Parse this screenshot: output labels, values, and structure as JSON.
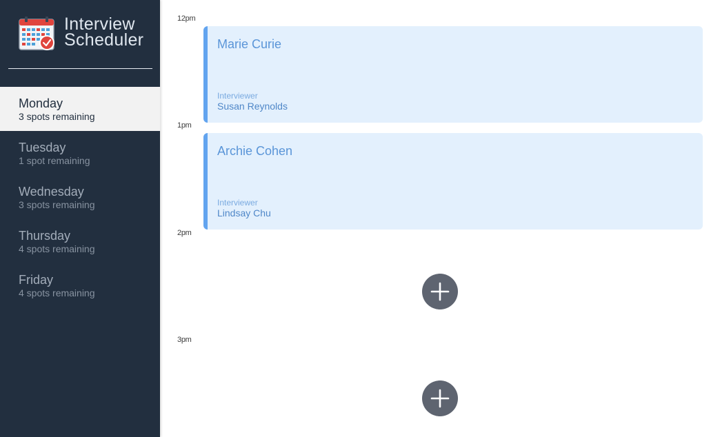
{
  "app": {
    "title_line1": "Interview",
    "title_line2": "Scheduler",
    "logo_icon": "calendar-check-icon"
  },
  "days": [
    {
      "name": "Monday",
      "spots": "3 spots remaining",
      "selected": true
    },
    {
      "name": "Tuesday",
      "spots": "1 spot remaining",
      "selected": false
    },
    {
      "name": "Wednesday",
      "spots": "3 spots remaining",
      "selected": false
    },
    {
      "name": "Thursday",
      "spots": "4 spots remaining",
      "selected": false
    },
    {
      "name": "Friday",
      "spots": "4 spots remaining",
      "selected": false
    }
  ],
  "schedule": {
    "slots": [
      {
        "time": "12pm",
        "student": "Marie Curie",
        "interviewer_label": "Interviewer",
        "interviewer": "Susan Reynolds"
      },
      {
        "time": "1pm",
        "student": "Archie Cohen",
        "interviewer_label": "Interviewer",
        "interviewer": "Lindsay Chu"
      },
      {
        "time": "2pm",
        "empty": true,
        "action_icon": "add-icon"
      },
      {
        "time": "3pm",
        "empty": true,
        "action_icon": "add-icon"
      }
    ]
  },
  "colors": {
    "sidebar_bg": "#222f3f",
    "selected_bg": "#f2f2f2",
    "card_bg": "#e3f0fd",
    "card_accent": "#62a4ef",
    "add_button": "#5e6470"
  }
}
